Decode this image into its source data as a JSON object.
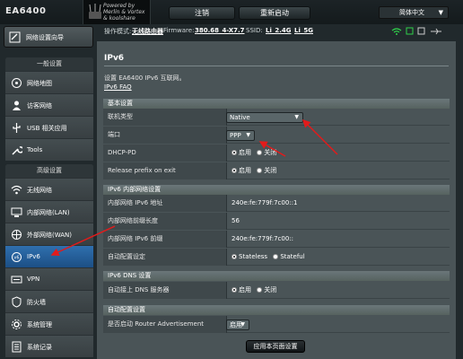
{
  "header": {
    "model": "EA6400",
    "brand_line1": "Powered by",
    "brand_line2": "Merlin & Vortex",
    "brand_line3": "& koolshare",
    "logout_label": "注销",
    "reboot_label": "重新启动",
    "language": "简体中文"
  },
  "status": {
    "mode_label": "操作模式:",
    "mode_value": "无线路由器",
    "firmware_label": "Firmware:",
    "firmware_value": "380.68_4-X7.7",
    "ssid_label": "SSID:",
    "ssid_value_1": "Li_2.4G",
    "ssid_value_2": "Li_5G"
  },
  "sidebar": {
    "top_item": "网络设置向导",
    "general_title": "一般设置",
    "general_items": [
      {
        "label": "网络地图",
        "icon": "network-map-icon"
      },
      {
        "label": "访客网络",
        "icon": "guest-network-icon"
      },
      {
        "label": "USB 相关应用",
        "icon": "usb-icon"
      },
      {
        "label": "Tools",
        "icon": "tools-icon"
      }
    ],
    "advanced_title": "高级设置",
    "advanced_items": [
      {
        "label": "无线网络",
        "icon": "wireless-icon"
      },
      {
        "label": "内部网络(LAN)",
        "icon": "lan-icon"
      },
      {
        "label": "外部网络(WAN)",
        "icon": "wan-icon"
      },
      {
        "label": "IPv6",
        "icon": "ipv6-icon"
      },
      {
        "label": "VPN",
        "icon": "vpn-icon"
      },
      {
        "label": "防火墙",
        "icon": "firewall-icon"
      },
      {
        "label": "系统管理",
        "icon": "admin-icon"
      },
      {
        "label": "系统记录",
        "icon": "log-icon"
      }
    ]
  },
  "main": {
    "title": "IPv6",
    "description": "设置 EA6400 IPv6 互联网。",
    "faq_link": "IPv6 FAQ",
    "sections": {
      "basic": "基本设置",
      "lan": "IPv6 内部网络设置",
      "dns": "IPv6 DNS 设置",
      "auto": "自动配置设置"
    },
    "basic": {
      "conn_type_label": "联机类型",
      "conn_type_value": "Native",
      "interface_label": "端口",
      "interface_value": "PPP",
      "dhcppd_label": "DHCP-PD",
      "release_label": "Release prefix on exit",
      "enable": "启用",
      "disable": "关闭"
    },
    "lan": {
      "addr_label": "内部网络 IPv6 地址",
      "addr_value": "240e:fe:779f:7c00::1",
      "prefix_len_label": "内部网络前缀长度",
      "prefix_len_value": "56",
      "prefix_label": "内部网络 IPv6 前缀",
      "prefix_value": "240e:fe:779f:7c00::",
      "autoconf_label": "自动配置设定",
      "stateless": "Stateless",
      "stateful": "Stateful"
    },
    "dns": {
      "auto_label": "自动接上 DNS 服务器",
      "enable": "启用",
      "disable": "关闭"
    },
    "auto": {
      "ra_label": "是否启动 Router Advertisement",
      "ra_value": "启用"
    },
    "apply_label": "应用本页面设置"
  },
  "colors": {
    "accent_active": "#2f6fae",
    "arrow": "#e21b1b",
    "wifi_green": "#2fd14a"
  }
}
